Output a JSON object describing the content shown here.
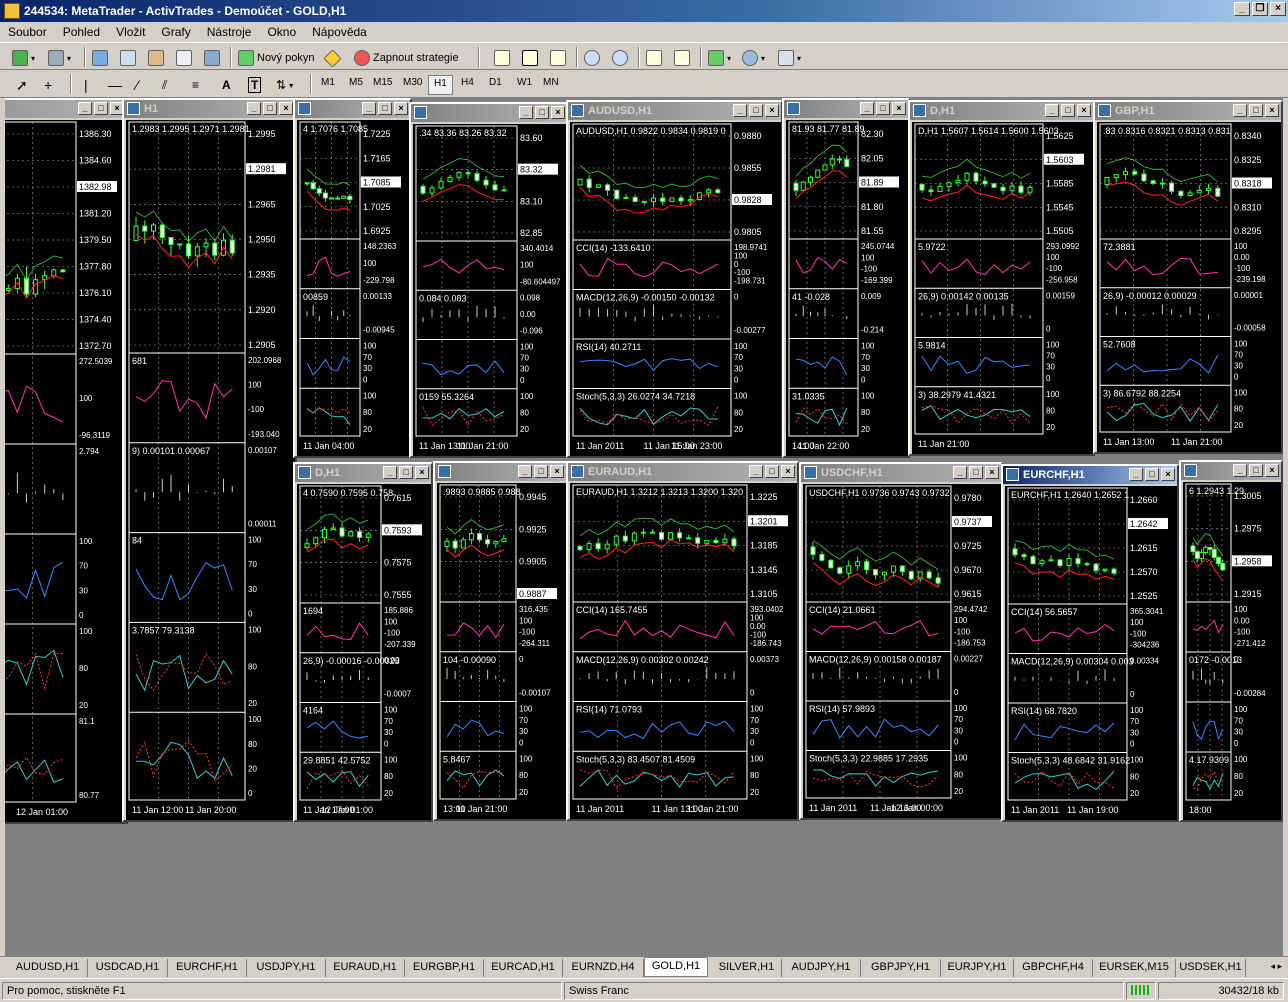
{
  "window": {
    "title": "244534: MetaTrader - ActivTrades - Demoúčet - GOLD,H1"
  },
  "menu": [
    "Soubor",
    "Pohled",
    "Vložit",
    "Grafy",
    "Nástroje",
    "Okno",
    "Nápověda"
  ],
  "toolbar": {
    "new_order": "Nový pokyn",
    "strategy": "Zapnout strategie"
  },
  "timeframes": [
    "M1",
    "M5",
    "M15",
    "M30",
    "H1",
    "H4",
    "D1",
    "W1",
    "MN"
  ],
  "active_timeframe": "H1",
  "tabs": [
    "AUDUSD,H1",
    "USDCAD,H1",
    "EURCHF,H1",
    "USDJPY,H1",
    "EURAUD,H1",
    "EURGBP,H1",
    "EURCAD,H1",
    "EURNZD,H4",
    "GOLD,H1",
    "SILVER,H1",
    "AUDJPY,H1",
    "GBPJPY,H1",
    "EURJPY,H1",
    "GBPCHF,H4",
    "EURSEK,M15",
    "USDSEK,H1"
  ],
  "active_tab": "GOLD,H1",
  "status": {
    "help": "Pro pomoc, stiskněte F1",
    "profile": "Swiss Franc",
    "traffic": "30432/18 kb"
  },
  "charts": [
    {
      "title": "",
      "header": ".75 1384.18 1381.",
      "prices": [
        "1386.30",
        "1384.60",
        "1382.98",
        "1381.20",
        "1379.50",
        "1377.80",
        "1376.10",
        "1374.40",
        "1372.70"
      ],
      "current": "1382.98",
      "sub": [
        {
          "label": "272",
          "scale": [
            "272.5039",
            "100",
            "-96.3119"
          ]
        },
        {
          "label": "1.908 1.950",
          "scale": [
            "2.794"
          ]
        },
        {
          "label": "",
          "scale": [
            "100",
            "70",
            "30",
            "0"
          ]
        },
        {
          "label": "2659 41.9936",
          "scale": [
            "100",
            "80",
            "20"
          ]
        },
        {
          "label": "",
          "scale": [
            "81.1",
            "80.77"
          ]
        }
      ],
      "times": [
        "Jan 17:00",
        "12 Jan 01:00"
      ]
    },
    {
      "title": "H1",
      "header": "1.2983 1.2995 1.2971 1.2981",
      "prices": [
        "1.2995",
        "1.2981",
        "1.2965",
        "1.2950",
        "1.2935",
        "1.2920",
        "1.2905"
      ],
      "current": "1.2981",
      "sub": [
        {
          "label": "681",
          "scale": [
            "202.0968",
            "100",
            "-100",
            "-193.040"
          ]
        },
        {
          "label": "9) 0.00101 0.00067",
          "scale": [
            "0.00107",
            "0.00011"
          ]
        },
        {
          "label": "84",
          "scale": [
            "100",
            "70",
            "30",
            "0"
          ]
        },
        {
          "label": "3.7857 79.3138",
          "scale": [
            "100",
            "80",
            "20"
          ]
        },
        {
          "label": "",
          "scale": [
            "100",
            "80",
            "20",
            "0"
          ]
        }
      ],
      "times": [
        "11 Jan 12:00",
        "11 Jan 20:00"
      ]
    },
    {
      "title": "",
      "header": "4 1.7076 1.7085",
      "prices": [
        "1.7225",
        "1.7165",
        "1.7085",
        "1.7025",
        "1.6925"
      ],
      "current": "1.7085",
      "sub": [
        {
          "label": "",
          "scale": [
            "148.2363",
            "100",
            "-229.798"
          ]
        },
        {
          "label": "00859",
          "scale": [
            "0.00133",
            "-0.00945"
          ]
        },
        {
          "label": "",
          "scale": [
            "100",
            "70",
            "30",
            "0"
          ]
        },
        {
          "label": "",
          "scale": [
            "100",
            "80",
            "20"
          ]
        }
      ],
      "times": [
        "11 Jan 04:00"
      ]
    },
    {
      "title": "",
      "header": ".34 83.36 83.26 83.32",
      "prices": [
        "83.60",
        "83.32",
        "83.10",
        "82.85"
      ],
      "current": "83.32",
      "sub": [
        {
          "label": "",
          "scale": [
            "340.4014",
            "100",
            "-80.604497"
          ]
        },
        {
          "label": "0.084 0.083",
          "scale": [
            "0.098",
            "0.00",
            "-0.096"
          ]
        },
        {
          "label": "",
          "scale": [
            "100",
            "70",
            "30",
            "0"
          ]
        },
        {
          "label": "0159 55.3264",
          "scale": [
            "100",
            "80",
            "20"
          ]
        }
      ],
      "times": [
        "11 Jan 13:00",
        "11 Jan 21:00"
      ]
    },
    {
      "title": "AUDUSD,H1",
      "header": "AUDUSD,H1 0.9822 0.9834 0.9819 0",
      "prices": [
        "0.9880",
        "0.9855",
        "0.9828",
        "0.9805"
      ],
      "current": "0.9828",
      "sub": [
        {
          "label": "CCI(14) -133.6410",
          "scale": [
            "198.9741",
            "100",
            "0",
            "-100",
            "-198.731"
          ]
        },
        {
          "label": "MACD(12,26,9) -0.00150 -0.00132",
          "scale": [
            "0",
            "-0.00277"
          ]
        },
        {
          "label": "RSI(14) 40.2711",
          "scale": [
            "100",
            "70",
            "30",
            "0"
          ]
        },
        {
          "label": "Stoch(5,3,3) 26.0274 34.7218",
          "scale": [
            "100",
            "80",
            "20"
          ]
        }
      ],
      "times": [
        "11 Jan 2011",
        "11 Jan 15:00",
        "11 Jan 23:00"
      ]
    },
    {
      "title": "",
      "header": "81.93 81.77 81.89",
      "prices": [
        "82.30",
        "82.05",
        "81.89",
        "81.80",
        "81.55"
      ],
      "current": "81.89",
      "sub": [
        {
          "label": "",
          "scale": [
            "245.0744",
            "100",
            "-100",
            "-169.399"
          ]
        },
        {
          "label": "41 -0.028",
          "scale": [
            "0.009",
            "-0.214"
          ]
        },
        {
          "label": "",
          "scale": [
            "100",
            "70",
            "30",
            "0"
          ]
        },
        {
          "label": "31.0335",
          "scale": [
            "100",
            "80",
            "20"
          ]
        }
      ],
      "times": [
        "14:00",
        "11 Jan 22:00"
      ]
    },
    {
      "title": "D,H1",
      "header": "D,H1 1.5607 1.5614 1.5600 1.5603",
      "prices": [
        "1.5625",
        "1.5603",
        "1.5585",
        "1.5545",
        "1.5505"
      ],
      "current": "1.5603",
      "sub": [
        {
          "label": "5.9722",
          "scale": [
            "293.0992",
            "100",
            "-100",
            "-256.958"
          ]
        },
        {
          "label": "26,9) 0.00142 0.00135",
          "scale": [
            "0.00159",
            "0"
          ]
        },
        {
          "label": "5.9814",
          "scale": [
            "100",
            "70",
            "30",
            "0"
          ]
        },
        {
          "label": "3) 38.2979 41.4321",
          "scale": [
            "100",
            "80",
            "20"
          ]
        }
      ],
      "times": [
        "11 Jan 21:00"
      ]
    },
    {
      "title": "GBP,H1",
      "header": ".83 0.8316 0.8321 0.8313 0.831",
      "prices": [
        "0.8340",
        "0.8325",
        "0.8318",
        "0.8310",
        "0.8295"
      ],
      "current": "0.8318",
      "sub": [
        {
          "label": "72.3881",
          "scale": [
            "100",
            "0.00",
            "-100",
            "-239.198"
          ]
        },
        {
          "label": "26,9) -0.00012 0.00029",
          "scale": [
            "0.00001",
            "-0.00058"
          ]
        },
        {
          "label": "52.7608",
          "scale": [
            "100",
            "70",
            "30",
            "0"
          ]
        },
        {
          "label": "3) 86.6792 88.2254",
          "scale": [
            "100",
            "80",
            "20"
          ]
        }
      ],
      "times": [
        "11 Jan 13:00",
        "11 Jan 21:00"
      ]
    },
    {
      "title": "D,H1",
      "header": "4 0.7590 0.7595 0.758",
      "prices": [
        "0.7615",
        "0.7593",
        "0.7575",
        "0.7555"
      ],
      "current": "0.7593",
      "sub": [
        {
          "label": "1694",
          "scale": [
            "185.886",
            "100",
            "-100",
            "-207.339"
          ]
        },
        {
          "label": "26,9) -0.00016 -0.00023",
          "scale": [
            "0.00",
            "-0.0007"
          ]
        },
        {
          "label": "4164",
          "scale": [
            "100",
            "70",
            "30",
            "0"
          ]
        },
        {
          "label": "29.8851 42.5752",
          "scale": [
            "100",
            "80",
            "20"
          ]
        }
      ],
      "times": [
        "11 Jan 17:00",
        "12 Jan 01:00"
      ]
    },
    {
      "title": "",
      "header": ".9893 0.9885 0.988",
      "prices": [
        "0.9945",
        "0.9925",
        "0.9905",
        "0.9887"
      ],
      "current": "0.9887",
      "sub": [
        {
          "label": "",
          "scale": [
            "316.435",
            "100",
            "-100",
            "-264.311"
          ]
        },
        {
          "label": "104 -0.00090",
          "scale": [
            "0",
            "-0.00107"
          ]
        },
        {
          "label": "",
          "scale": [
            "100",
            "70",
            "30",
            "0"
          ]
        },
        {
          "label": "5.8467",
          "scale": [
            "100",
            "80",
            "20"
          ]
        }
      ],
      "times": [
        "13:00",
        "11 Jan 21:00"
      ]
    },
    {
      "title": "EURAUD,H1",
      "header": "EURAUD,H1 1.3212 1.3213 1.3200 1.320",
      "prices": [
        "1.3225",
        "1.3201",
        "1.3185",
        "1.3145",
        "1.3105"
      ],
      "current": "1.3201",
      "sub": [
        {
          "label": "CCI(14) 165.7455",
          "scale": [
            "393.0402",
            "100",
            "0.00",
            "-100",
            "-186.743"
          ]
        },
        {
          "label": "MACD(12,26,9) 0.00302 0.00242",
          "scale": [
            "0.00373",
            "0"
          ]
        },
        {
          "label": "RSI(14) 71.0793",
          "scale": [
            "100",
            "70",
            "30",
            "0"
          ]
        },
        {
          "label": "Stoch(5,3,3) 83.4507 81.4509",
          "scale": [
            "100",
            "80",
            "20"
          ]
        }
      ],
      "times": [
        "11 Jan 2011",
        "11 Jan 13:00",
        "11 Jan 21:00"
      ]
    },
    {
      "title": "USDCHF,H1",
      "header": "USDCHF,H1 0.9736 0.9743 0.9732",
      "prices": [
        "0.9780",
        "0.9737",
        "0.9725",
        "0.9670",
        "0.9615"
      ],
      "current": "0.9737",
      "sub": [
        {
          "label": "CCI(14) 21.0661",
          "scale": [
            "294.4742",
            "100",
            "-100",
            "-186.753"
          ]
        },
        {
          "label": "MACD(12,26,9) 0.00158 0.00187",
          "scale": [
            "0.00227",
            "0"
          ]
        },
        {
          "label": "RSI(14) 57.9893",
          "scale": [
            "100",
            "70",
            "30",
            "0"
          ]
        },
        {
          "label": "Stoch(5,3,3) 22.9885 17.2935",
          "scale": [
            "100",
            "80",
            "20"
          ]
        }
      ],
      "times": [
        "11 Jan 2011",
        "11 Jan 16:00",
        "12 Jan 00:00"
      ]
    },
    {
      "title": "EURCHF,H1",
      "header": "EURCHF,H1 1.2640 1.2652 1",
      "prices": [
        "1.2660",
        "1.2642",
        "1.2615",
        "1.2570",
        "1.2525"
      ],
      "current": "1.2642",
      "sub": [
        {
          "label": "CCI(14) 56.5657",
          "scale": [
            "365.3041",
            "100",
            "-100",
            "-304236"
          ]
        },
        {
          "label": "MACD(12,26,9) 0.00304 0.003",
          "scale": [
            "0.00334",
            "0"
          ]
        },
        {
          "label": "RSI(14) 68.7820",
          "scale": [
            "100",
            "70",
            "30",
            "0"
          ]
        },
        {
          "label": "Stoch(5,3,3) 48.6842 31.9162",
          "scale": [
            "100",
            "80",
            "20"
          ]
        }
      ],
      "times": [
        "11 Jan 2011",
        "11 Jan 19:00"
      ]
    },
    {
      "title": "",
      "header": "6 1.2943 1.29",
      "prices": [
        "1.3005",
        "1.2975",
        "1.2958",
        "1.2915"
      ],
      "current": "1.2958",
      "sub": [
        {
          "label": "",
          "scale": [
            "100",
            "0.00",
            "-100",
            "-271.412"
          ]
        },
        {
          "label": "0172 -0.0013",
          "scale": [
            "0",
            "-0.00284"
          ]
        },
        {
          "label": "",
          "scale": [
            "100",
            "70",
            "30",
            "0"
          ]
        },
        {
          "label": "4.17.9309",
          "scale": [
            "100",
            "80",
            "20"
          ]
        }
      ],
      "times": [
        "18:00"
      ]
    }
  ]
}
